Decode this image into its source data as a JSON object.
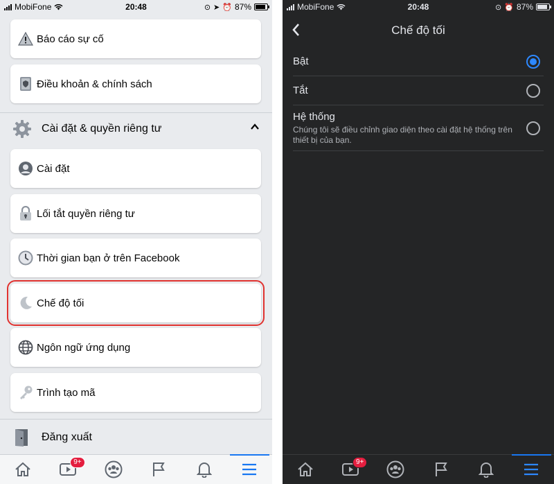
{
  "status_bar": {
    "carrier": "MobiFone",
    "time": "20:48",
    "battery": "87%",
    "battery_level": 0.87
  },
  "left": {
    "menu_items": [
      {
        "label": "Báo cáo sự cố",
        "icon": "warning-icon"
      },
      {
        "label": "Điều khoản & chính sách",
        "icon": "book-icon"
      }
    ],
    "section": {
      "label": "Cài đặt & quyền riêng tư",
      "icon": "gear-icon",
      "expanded": true
    },
    "settings_items": [
      {
        "label": "Cài đặt",
        "icon": "profile-icon"
      },
      {
        "label": "Lối tắt quyền riêng tư",
        "icon": "lock-icon"
      },
      {
        "label": "Thời gian bạn ở trên Facebook",
        "icon": "clock-icon"
      },
      {
        "label": "Chế độ tối",
        "icon": "moon-icon",
        "highlighted": true
      },
      {
        "label": "Ngôn ngữ ứng dụng",
        "icon": "globe-icon"
      },
      {
        "label": "Trình tạo mã",
        "icon": "key-icon"
      }
    ],
    "logout": {
      "label": "Đăng xuất",
      "icon": "logout-icon"
    }
  },
  "tab_bar": {
    "tabs": [
      "home-icon",
      "watch-icon",
      "groups-icon",
      "pages-flag-icon",
      "notifications-bell-icon",
      "menu-icon"
    ],
    "watch_badge": "9+",
    "active": "menu-icon"
  },
  "right": {
    "title": "Chế độ tối",
    "options": [
      {
        "label": "Bật",
        "selected": true
      },
      {
        "label": "Tắt",
        "selected": false
      },
      {
        "label": "Hệ thống",
        "description": "Chúng tôi sẽ điều chỉnh giao diện theo cài đặt hệ thống trên thiết bị của bạn.",
        "selected": false
      }
    ]
  },
  "colors": {
    "accent": "#1877f2",
    "highlight_border": "#e0322f",
    "dark_bg": "#242526",
    "light_bg": "#e9ebee",
    "badge": "#e41e3f"
  }
}
